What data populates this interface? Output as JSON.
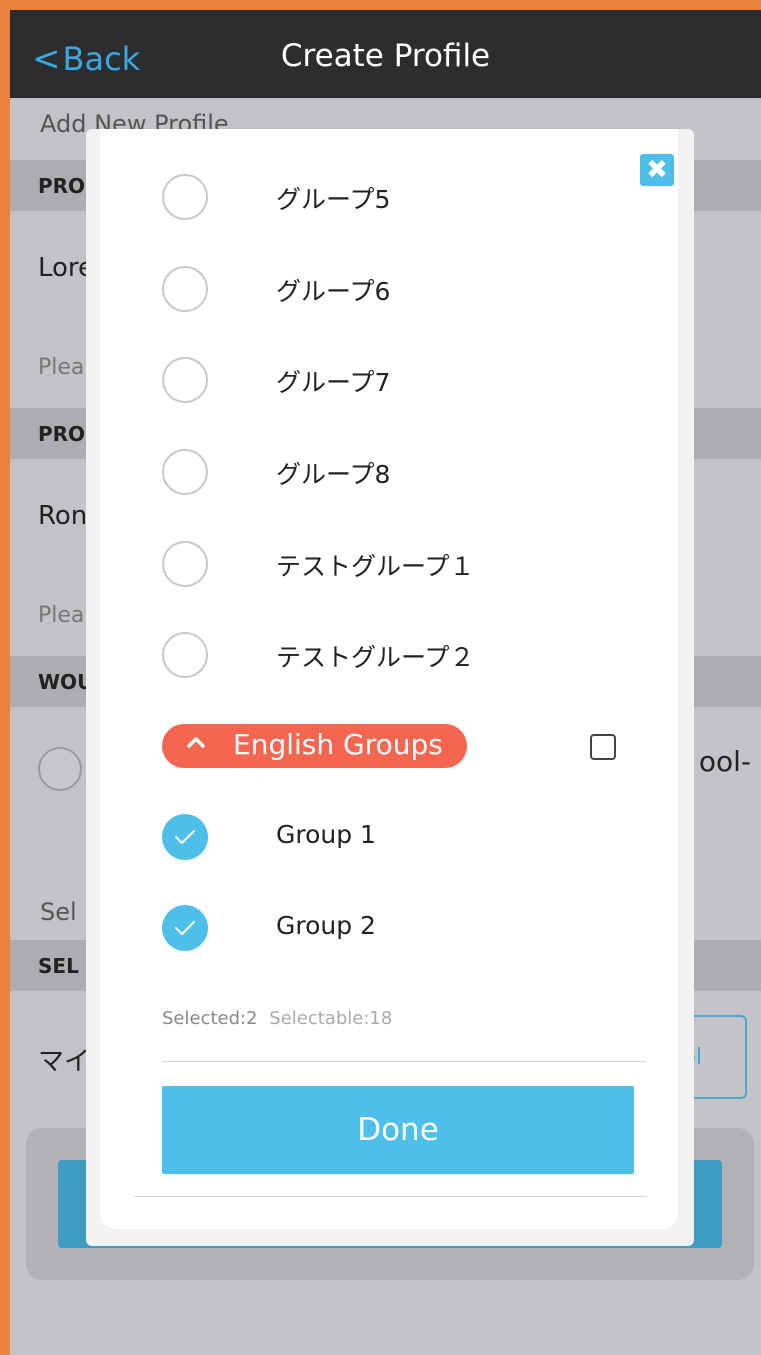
{
  "nav": {
    "back_label": "Back",
    "title": "Create Profile"
  },
  "background": {
    "add_new_profile": "Add New Profile",
    "section1_header": "PRO",
    "section1_value": "Lore",
    "section1_hint": "Plea",
    "section2_header": "PRO",
    "section2_value": "Ron",
    "section2_hint": "Plea",
    "section3_header": "WOU",
    "section3_right_text": "ool-",
    "select_label": "Sel",
    "section4_header": "SEL",
    "section4_value": "マイ",
    "section4_button": "ool"
  },
  "modal": {
    "close_label": "✖",
    "options": [
      {
        "label": "グループ5",
        "selected": false
      },
      {
        "label": "グループ6",
        "selected": false
      },
      {
        "label": "グループ7",
        "selected": false
      },
      {
        "label": "グループ8",
        "selected": false
      },
      {
        "label": "テストグループ１",
        "selected": false
      },
      {
        "label": "テストグループ２",
        "selected": false
      }
    ],
    "group_header": {
      "label": "English Groups",
      "expanded": true,
      "select_all": false
    },
    "group_options": [
      {
        "label": "Group 1",
        "selected": true
      },
      {
        "label": "Group 2",
        "selected": true
      }
    ],
    "selected_text": "Selected:2",
    "selectable_text": "Selectable:18",
    "done_label": "Done"
  },
  "colors": {
    "accent": "#4ebfe9",
    "group_pill": "#f4664f",
    "navbar": "#2b2d2f",
    "frame": "#e9823a"
  }
}
